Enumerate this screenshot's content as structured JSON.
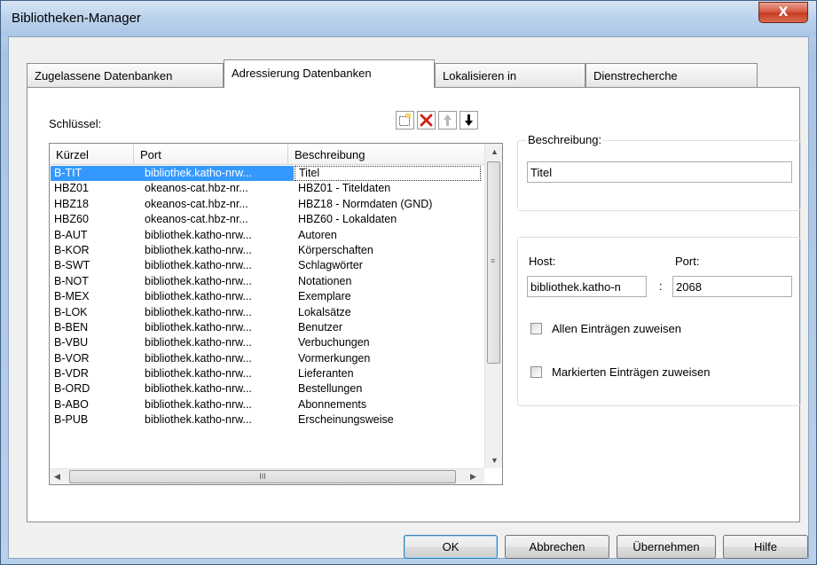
{
  "window": {
    "title": "Bibliotheken-Manager",
    "close_label": "X"
  },
  "tabs": [
    {
      "label": "Zugelassene Datenbanken",
      "active": false
    },
    {
      "label": "Adressierung Datenbanken",
      "active": true
    },
    {
      "label": "Lokalisieren in",
      "active": false
    },
    {
      "label": "Dienstrecherche",
      "active": false
    }
  ],
  "keys_panel": {
    "label": "Schlüssel:",
    "toolbar": [
      "new-icon",
      "delete-icon",
      "move-up-icon",
      "move-down-icon"
    ],
    "columns": [
      "Kürzel",
      "Port",
      "Beschreibung"
    ],
    "selected_index": 0,
    "rows": [
      {
        "kuerzel": "B-TIT",
        "port": "bibliothek.katho-nrw...",
        "beschreibung": "Titel"
      },
      {
        "kuerzel": "HBZ01",
        "port": "okeanos-cat.hbz-nr...",
        "beschreibung": "HBZ01 - Titeldaten"
      },
      {
        "kuerzel": "HBZ18",
        "port": "okeanos-cat.hbz-nr...",
        "beschreibung": "HBZ18 - Normdaten (GND)"
      },
      {
        "kuerzel": "HBZ60",
        "port": "okeanos-cat.hbz-nr...",
        "beschreibung": "HBZ60 - Lokaldaten"
      },
      {
        "kuerzel": "B-AUT",
        "port": "bibliothek.katho-nrw...",
        "beschreibung": "Autoren"
      },
      {
        "kuerzel": "B-KOR",
        "port": "bibliothek.katho-nrw...",
        "beschreibung": "Körperschaften"
      },
      {
        "kuerzel": "B-SWT",
        "port": "bibliothek.katho-nrw...",
        "beschreibung": "Schlagwörter"
      },
      {
        "kuerzel": "B-NOT",
        "port": "bibliothek.katho-nrw...",
        "beschreibung": "Notationen"
      },
      {
        "kuerzel": "B-MEX",
        "port": "bibliothek.katho-nrw...",
        "beschreibung": "Exemplare"
      },
      {
        "kuerzel": "B-LOK",
        "port": "bibliothek.katho-nrw...",
        "beschreibung": "Lokalsätze"
      },
      {
        "kuerzel": "B-BEN",
        "port": "bibliothek.katho-nrw...",
        "beschreibung": "Benutzer"
      },
      {
        "kuerzel": "B-VBU",
        "port": "bibliothek.katho-nrw...",
        "beschreibung": "Verbuchungen"
      },
      {
        "kuerzel": "B-VOR",
        "port": "bibliothek.katho-nrw...",
        "beschreibung": "Vormerkungen"
      },
      {
        "kuerzel": "B-VDR",
        "port": "bibliothek.katho-nrw...",
        "beschreibung": "Lieferanten"
      },
      {
        "kuerzel": "B-ORD",
        "port": "bibliothek.katho-nrw...",
        "beschreibung": "Bestellungen"
      },
      {
        "kuerzel": "B-ABO",
        "port": "bibliothek.katho-nrw...",
        "beschreibung": "Abonnements"
      },
      {
        "kuerzel": "B-PUB",
        "port": "bibliothek.katho-nrw...",
        "beschreibung": "Erscheinungsweise"
      }
    ],
    "hscroll_grip": "III"
  },
  "description_group": {
    "title": "Beschreibung:",
    "value": "Titel"
  },
  "host_group": {
    "host_label": "Host:",
    "host_value": "bibliothek.katho-n",
    "separator": ":",
    "port_label": "Port:",
    "port_value": "2068",
    "assign_all_label": "Allen Einträgen zuweisen",
    "assign_all_checked": false,
    "assign_marked_label": "Markierten Einträgen zuweisen",
    "assign_marked_checked": false
  },
  "buttons": {
    "ok": "OK",
    "cancel": "Abbrechen",
    "apply": "Übernehmen",
    "help": "Hilfe"
  },
  "colors": {
    "selection": "#3399ff",
    "close_button": "#c53a1f"
  }
}
